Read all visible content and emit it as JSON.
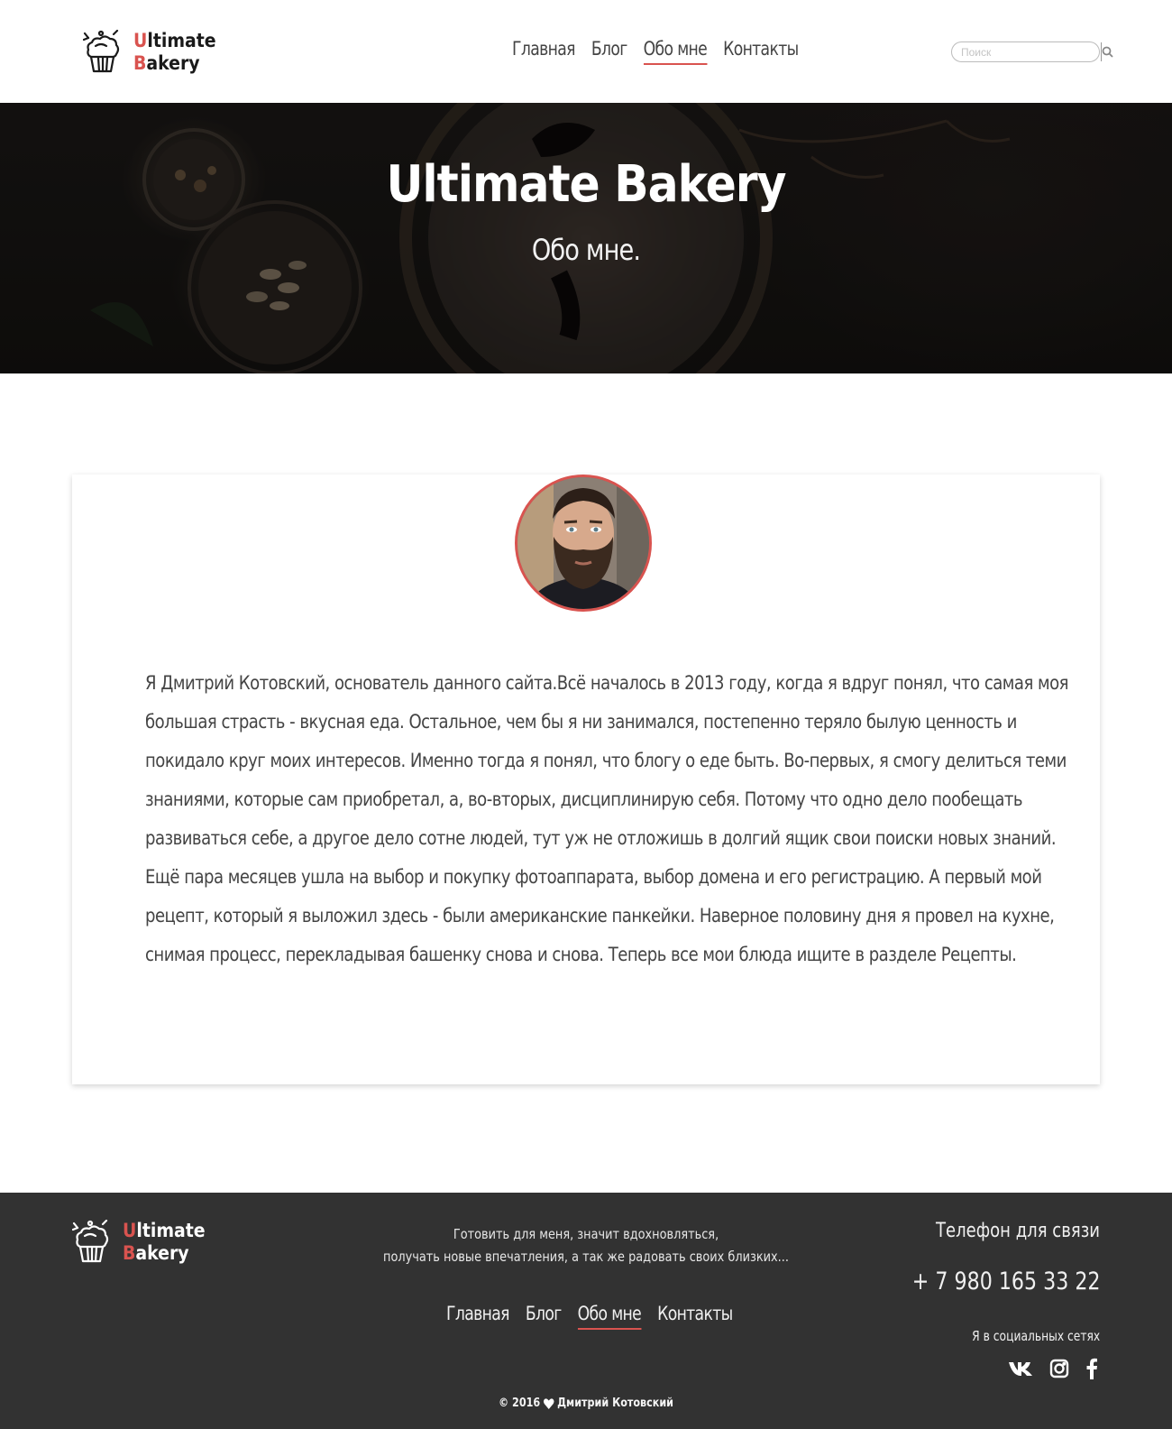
{
  "brand": {
    "line1_initial": "U",
    "line1_rest": "ltimate",
    "line2_initial": "B",
    "line2_rest": "akery",
    "accent_color": "#d9534f"
  },
  "nav": {
    "items": [
      {
        "label": "Главная",
        "active": false
      },
      {
        "label": "Блог",
        "active": false
      },
      {
        "label": "Обо мне",
        "active": true
      },
      {
        "label": "Контакты",
        "active": false
      }
    ]
  },
  "search": {
    "placeholder": "Поиск",
    "icon": "search-icon"
  },
  "hero": {
    "title": "Ultimate Bakery",
    "subtitle": "Обо мне."
  },
  "about": {
    "paragraph1": "Я Дмитрий Котовский, основатель данного сайта.Всё началось в 2013 году, когда я вдруг понял, что самая моя большая страсть - вкусная еда. Остальное, чем бы я ни занимался, постепенно теряло былую ценность и покидало круг моих интересов. Именно  тогда я понял, что блогу о еде быть. Во-первых, я смогу делиться теми знаниями, которые сам приобретал, а, во-вторых, дисциплинирую себя. Потому что одно дело пообещать развиваться себе, а другое дело сотне людей, тут уж не отложишь в долгий ящик свои поиски новых знаний.",
    "paragraph2": "Ещё пара месяцев ушла на выбор и покупку фотоаппарата, выбор домена и его регистрацию. А первый мой рецепт, который я выложил здесь - были американские панкейки. Наверное половину дня я провел на кухне, снимая процесс, перекладывая башенку снова и снова. Теперь все мои блюда ищите в разделе Рецепты."
  },
  "footer": {
    "tagline_line1": "Готовить для меня, значит вдохновляться,",
    "tagline_line2": "получать новые впечатления, а так же радовать своих близких...",
    "phone_label": "Телефон для связи",
    "phone_number": "+ 7 980 165 33 22",
    "social_label": "Я в социальных сетях",
    "socials": [
      "vk-icon",
      "instagram-icon",
      "facebook-icon"
    ],
    "copyright_year": "© 2016",
    "copyright_name": "Дмитрий Котовский"
  }
}
